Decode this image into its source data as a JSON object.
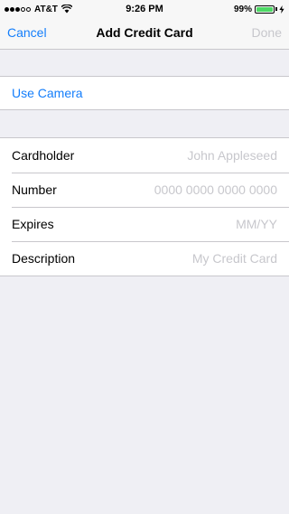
{
  "status_bar": {
    "carrier": "AT&T",
    "time": "9:26 PM",
    "battery_percent": "99%",
    "battery_level": 0.99,
    "signal_bars_filled": 3,
    "signal_bars_total": 5,
    "battery_color": "#4cd964"
  },
  "nav": {
    "cancel_label": "Cancel",
    "title": "Add Credit Card",
    "done_label": "Done"
  },
  "camera": {
    "label": "Use Camera"
  },
  "form": {
    "cardholder": {
      "label": "Cardholder",
      "placeholder": "John Appleseed"
    },
    "number": {
      "label": "Number",
      "placeholder": "0000 0000 0000 0000"
    },
    "expires": {
      "label": "Expires",
      "placeholder": "MM/YY"
    },
    "description": {
      "label": "Description",
      "placeholder": "My Credit Card"
    }
  },
  "colors": {
    "accent": "#147efb",
    "disabled": "#c7c7cc",
    "background": "#efeff4"
  }
}
